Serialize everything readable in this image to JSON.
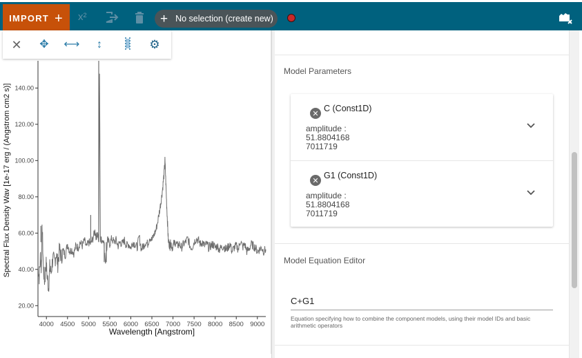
{
  "toolbar": {
    "import_label": "IMPORT",
    "selection_label": "No selection (create new)",
    "colors": {
      "bar": "#00617e",
      "import": "#c75109",
      "pill": "#4a5458",
      "record": "#c62828"
    }
  },
  "viewer": {
    "tools": [
      "close-icon",
      "pan-zoom-icon",
      "horizontal-zoom-icon",
      "vertical-zoom-icon",
      "range-select-icon",
      "gear-icon"
    ]
  },
  "right_panel": {
    "model_parameters_title": "Model Parameters",
    "parameters": [
      {
        "name": "C (Const1D)",
        "label": "amplitude :",
        "value_lines": [
          "51.8804168",
          "7011719"
        ]
      },
      {
        "name": "G1 (Const1D)",
        "label": "amplitude :",
        "value_lines": [
          "51.8804168",
          "7011719"
        ]
      }
    ],
    "equation_editor_title": "Model Equation Editor",
    "equation_value": "C+G1",
    "equation_help": "Equation specifying how to combine the component models, using their model IDs and basic arithmetic operators"
  },
  "chart_data": {
    "type": "line",
    "xlabel": "Wavelength [Angstrom]",
    "ylabel": "Spectral Flux Density Wav [1e-17 erg / (Angstrom cm2 s)]",
    "xlim": [
      3800,
      9200
    ],
    "ylim": [
      14,
      155
    ],
    "x_ticks": [
      4000,
      4500,
      5000,
      5500,
      6000,
      6500,
      7000,
      7500,
      8000,
      8500,
      9000
    ],
    "y_ticks": [
      20.0,
      40.0,
      60.0,
      80.0,
      100.0,
      120.0,
      140.0
    ],
    "y_tick_labels": [
      "20.00",
      "40.00",
      "60.00",
      "80.00",
      "100.00",
      "120.00",
      "140.00"
    ],
    "series": [
      {
        "color": "#6e6e6e",
        "x": [
          3800,
          3830,
          3860,
          3880,
          3900,
          3930,
          3960,
          3990,
          4020,
          4050,
          4080,
          4110,
          4150,
          4190,
          4230,
          4270,
          4310,
          4350,
          4400,
          4450,
          4500,
          4550,
          4600,
          4650,
          4700,
          4750,
          4800,
          4850,
          4900,
          4950,
          5000,
          5050,
          5100,
          5150,
          5180,
          5210,
          5240,
          5260,
          5280,
          5300,
          5350,
          5400,
          5450,
          5500,
          5550,
          5600,
          5650,
          5700,
          5750,
          5800,
          5850,
          5900,
          5950,
          6000,
          6050,
          6100,
          6150,
          6200,
          6250,
          6300,
          6350,
          6400,
          6450,
          6500,
          6550,
          6600,
          6650,
          6700,
          6730,
          6760,
          6790,
          6810,
          6830,
          6850,
          6870,
          6890,
          6910,
          6930,
          6950,
          6980,
          7020,
          7060,
          7100,
          7150,
          7200,
          7250,
          7300,
          7350,
          7400,
          7450,
          7500,
          7550,
          7600,
          7650,
          7700,
          7750,
          7800,
          7850,
          7900,
          7950,
          8000,
          8050,
          8100,
          8150,
          8200,
          8250,
          8300,
          8350,
          8400,
          8450,
          8500,
          8550,
          8600,
          8650,
          8700,
          8750,
          8800,
          8850,
          8900,
          8950,
          9000,
          9050,
          9100,
          9150,
          9200
        ],
        "y": [
          42,
          36,
          48,
          40,
          64,
          40,
          33,
          44,
          36,
          30,
          41,
          38,
          46,
          44,
          49,
          43,
          51,
          47,
          50,
          48,
          54,
          50,
          51,
          49,
          53,
          52,
          55,
          53,
          56,
          52,
          55,
          54,
          57,
          61,
          58,
          60,
          55,
          150,
          58,
          56,
          57,
          44,
          56,
          54,
          57,
          55,
          56,
          53,
          55,
          54,
          56,
          53,
          54,
          52,
          55,
          54,
          52,
          58,
          51,
          53,
          55,
          54,
          58,
          56,
          59,
          62,
          68,
          75,
          80,
          86,
          93,
          100,
          88,
          76,
          66,
          56,
          54,
          53,
          55,
          52,
          54,
          55,
          53,
          54,
          52,
          54,
          55,
          57,
          53,
          52,
          55,
          57,
          56,
          54,
          55,
          53,
          54,
          52,
          53,
          54,
          52,
          53,
          51,
          52,
          53,
          51,
          52,
          54,
          50,
          52,
          53,
          51,
          56,
          52,
          54,
          50,
          51,
          54,
          53,
          52,
          50,
          51,
          52,
          50,
          51
        ]
      }
    ],
    "spikes": [
      {
        "x": 3870,
        "y": 64
      },
      {
        "x": 5050,
        "y": 70
      },
      {
        "x": 5180,
        "y": 55
      },
      {
        "x": 5240,
        "y": 155
      },
      {
        "x": 5370,
        "y": 44
      },
      {
        "x": 5420,
        "y": 44
      }
    ]
  }
}
